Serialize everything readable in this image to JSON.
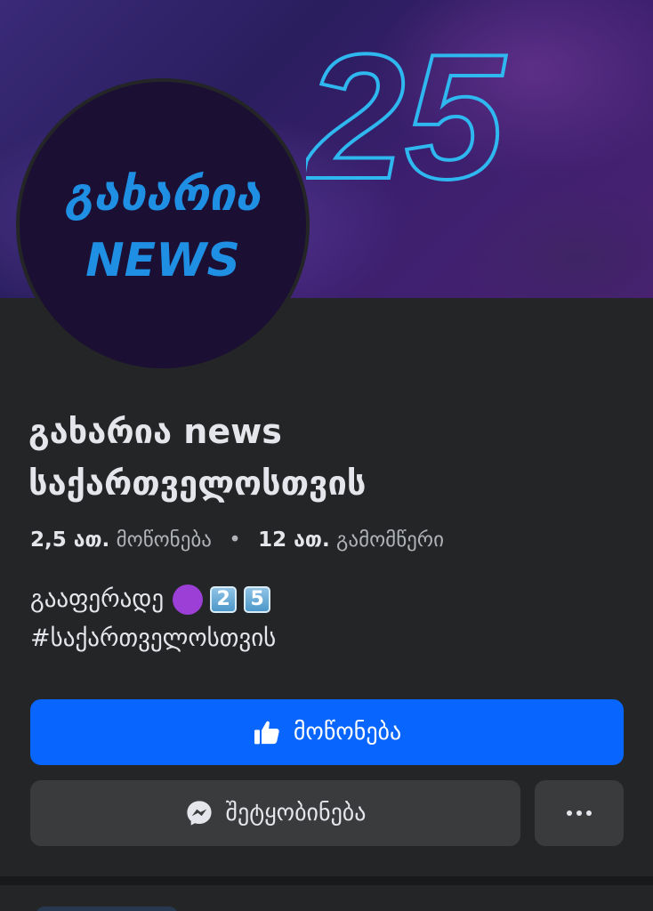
{
  "cover": {
    "number": "25",
    "colors": {
      "accent": "#2fb8f0",
      "background": "#3a2a78"
    }
  },
  "avatar": {
    "line1": "გახარია",
    "line2": "NEWS",
    "color": "#1f8fe3"
  },
  "page": {
    "title_line1": "გახარია news",
    "title_line2": "საქართველოსთვის"
  },
  "stats": {
    "likes_count": "2,5 ათ.",
    "likes_label": "მოწონება",
    "separator": "•",
    "followers_count": "12 ათ.",
    "followers_label": "გამომწერი"
  },
  "bio": {
    "line1": "გააფერადე",
    "emoji_purple_circle": "purple-circle-icon",
    "keycap1": "2",
    "keycap2": "5",
    "line2": "#საქართველოსთვის"
  },
  "buttons": {
    "like_label": "მოწონება",
    "like_icon": "thumbs-up-icon",
    "message_label": "შეტყობინება",
    "message_icon": "messenger-icon",
    "more_icon": "more-dots-icon",
    "like_color": "#0866ff"
  }
}
